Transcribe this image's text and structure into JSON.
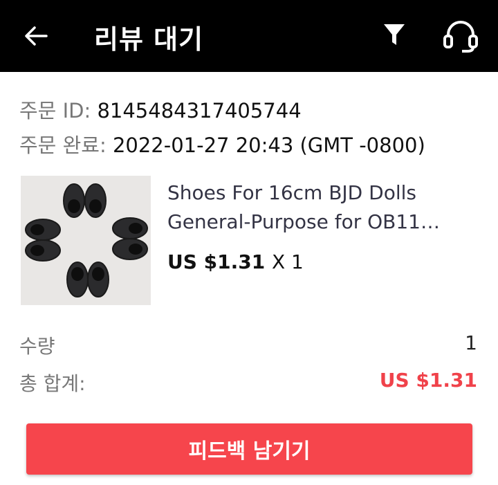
{
  "header": {
    "title": "리뷰 대기",
    "icons": {
      "back": "arrow-left-icon",
      "filter": "filter-icon",
      "support": "headset-icon"
    },
    "background": "#000000"
  },
  "order": {
    "id_label": "주문 ID:",
    "id_value": "8145484317405744",
    "completed_label": "주문 완료:",
    "completed_value": "2022-01-27 20:43 (GMT -0800)"
  },
  "product": {
    "title_line1": "Shoes For 16cm BJD Dolls",
    "title_line2": "General-Purpose for OB11…",
    "price": "US $1.31",
    "multiplier": "X 1"
  },
  "summary": {
    "quantity_label": "수량",
    "quantity_value": "1",
    "total_label": "총 합계:",
    "total_value": "US $1.31"
  },
  "actions": {
    "feedback_label": "피드백 남기기"
  },
  "colors": {
    "accent": "#f6454c",
    "total_text": "#f0424a"
  }
}
